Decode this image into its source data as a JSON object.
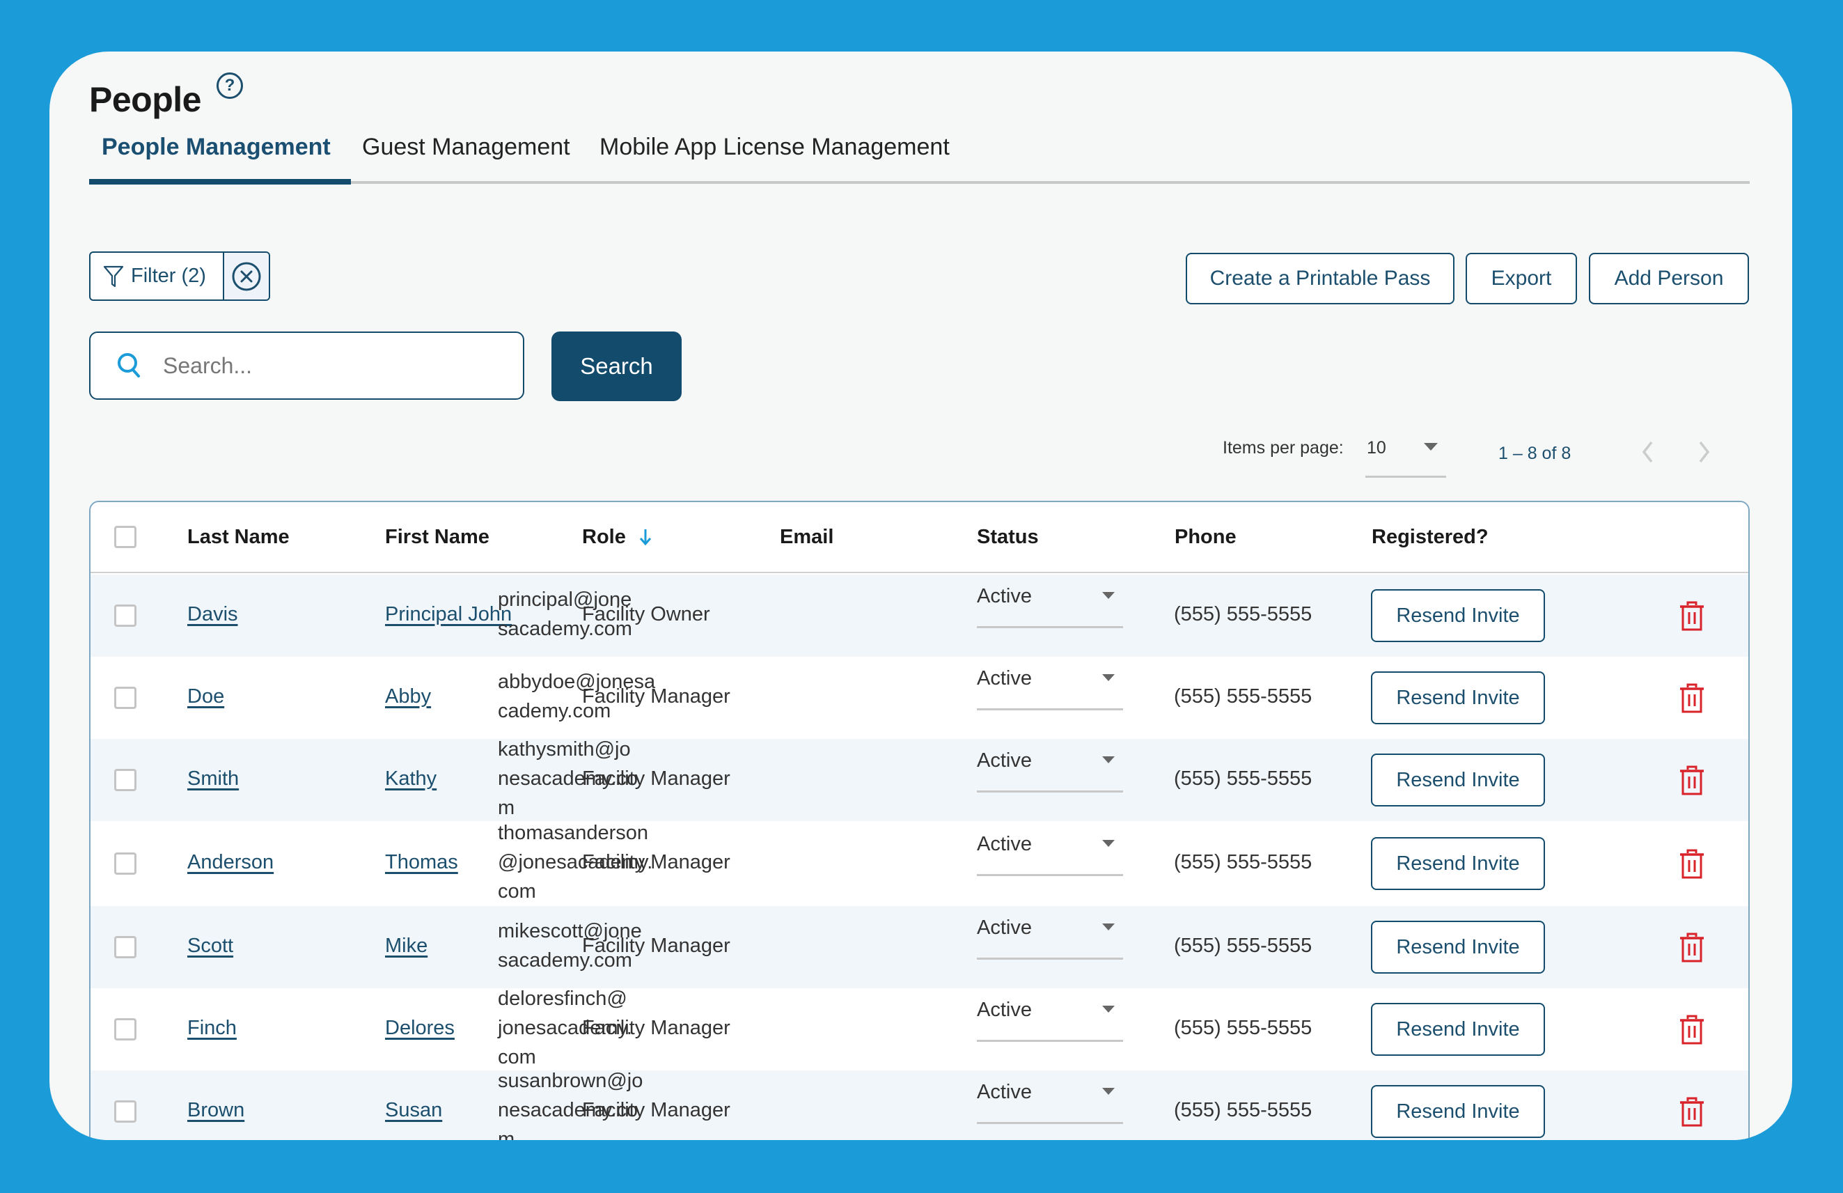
{
  "page": {
    "title": "People",
    "help_icon": "help-circle-icon"
  },
  "tabs": [
    {
      "label": "People Management",
      "active": true
    },
    {
      "label": "Guest Management",
      "active": false
    },
    {
      "label": "Mobile App License Management",
      "active": false
    }
  ],
  "filter": {
    "label": "Filter (2)",
    "icon": "funnel-icon",
    "clear_icon": "close-circle-icon"
  },
  "search": {
    "placeholder": "Search...",
    "value": "",
    "button_label": "Search",
    "icon": "search-icon"
  },
  "actions": {
    "printable_pass": "Create a Printable Pass",
    "export": "Export",
    "add_person": "Add Person"
  },
  "pagination": {
    "items_per_page_label": "Items per page:",
    "items_per_page": "10",
    "range": "1 – 8 of 8"
  },
  "table": {
    "columns": {
      "last_name": "Last Name",
      "first_name": "First Name",
      "role": "Role",
      "email": "Email",
      "status": "Status",
      "phone": "Phone",
      "registered": "Registered?"
    },
    "sort": {
      "column": "role",
      "direction": "descending"
    },
    "resend_label": "Resend Invite",
    "rows": [
      {
        "last_name": "Davis",
        "first_name": "Principal John",
        "role": "Facility Owner",
        "email": "principal@jonesacademy.com",
        "status": "Active",
        "phone": "(555) 555-5555"
      },
      {
        "last_name": "Doe",
        "first_name": "Abby",
        "role": "Facility Manager",
        "email": "abbydoe@jonesacademy.com",
        "status": "Active",
        "phone": "(555) 555-5555"
      },
      {
        "last_name": "Smith",
        "first_name": "Kathy",
        "role": "Facility Manager",
        "email": "kathysmith@jonesacademy.com",
        "status": "Active",
        "phone": "(555) 555-5555"
      },
      {
        "last_name": "Anderson",
        "first_name": "Thomas",
        "role": "Facility Manager",
        "email": "thomasanderson@jonesacademy.com",
        "status": "Active",
        "phone": "(555) 555-5555"
      },
      {
        "last_name": "Scott",
        "first_name": "Mike",
        "role": "Facility Manager",
        "email": "mikescott@jonesacademy.com",
        "status": "Active",
        "phone": "(555) 555-5555"
      },
      {
        "last_name": "Finch",
        "first_name": "Delores",
        "role": "Facility Manager",
        "email": "deloresfinch@jonesacademy.com",
        "status": "Active",
        "phone": "(555) 555-5555"
      },
      {
        "last_name": "Brown",
        "first_name": "Susan",
        "role": "Facility Manager",
        "email": "susanbrown@jonesacademy.com",
        "status": "Active",
        "phone": "(555) 555-5555"
      }
    ]
  },
  "colors": {
    "frame": "#1b9bd7",
    "primary": "#124b6c",
    "danger": "#d8232a",
    "row_alt": "#f1f6fa"
  }
}
